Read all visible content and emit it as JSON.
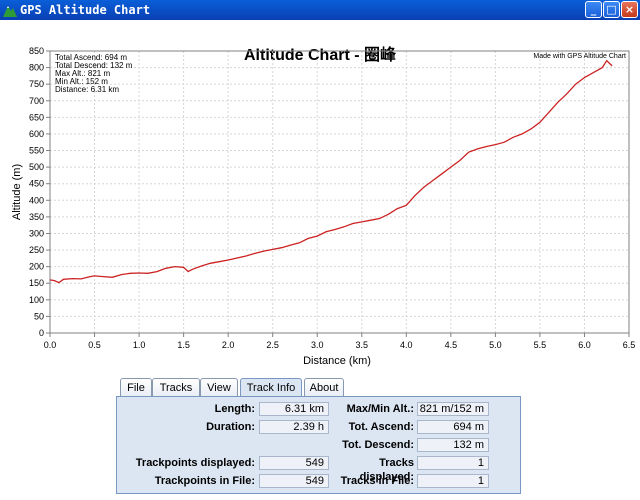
{
  "window": {
    "title": "GPS Altitude Chart",
    "buttons": {
      "minimize": "_",
      "maximize": "□",
      "close": "×"
    }
  },
  "chart": {
    "title": "Altitude Chart - 圈峰",
    "stats": [
      "Total Ascend: 694 m",
      "Total Descend: 132 m",
      "Max Alt.: 821 m",
      "Min Alt.: 152 m",
      "Distance: 6.31 km"
    ],
    "watermark": "Made with GPS Altitude Chart"
  },
  "chart_data": {
    "type": "line",
    "title": "Altitude Chart - 圈峰",
    "xlabel": "Distance (km)",
    "ylabel": "Altitude (m)",
    "xlim": [
      0,
      6.5
    ],
    "ylim": [
      0,
      850
    ],
    "xticks": [
      "0.0",
      "0.5",
      "1.0",
      "1.5",
      "2.0",
      "2.5",
      "3.0",
      "3.5",
      "4.0",
      "4.5",
      "5.0",
      "5.5",
      "6.0",
      "6.5"
    ],
    "yticks": [
      "0",
      "50",
      "100",
      "150",
      "200",
      "250",
      "300",
      "350",
      "400",
      "450",
      "500",
      "550",
      "600",
      "650",
      "700",
      "750",
      "800",
      "850"
    ],
    "grid": true,
    "series": [
      {
        "color": "#cc2222",
        "x": [
          0.0,
          0.05,
          0.1,
          0.15,
          0.25,
          0.35,
          0.45,
          0.5,
          0.6,
          0.7,
          0.8,
          0.9,
          1.0,
          1.1,
          1.2,
          1.3,
          1.4,
          1.5,
          1.55,
          1.6,
          1.7,
          1.8,
          1.9,
          2.0,
          2.1,
          2.2,
          2.3,
          2.4,
          2.5,
          2.6,
          2.7,
          2.8,
          2.9,
          3.0,
          3.1,
          3.2,
          3.3,
          3.4,
          3.5,
          3.6,
          3.7,
          3.8,
          3.9,
          4.0,
          4.1,
          4.2,
          4.3,
          4.4,
          4.5,
          4.6,
          4.7,
          4.8,
          4.9,
          5.0,
          5.1,
          5.2,
          5.3,
          5.4,
          5.5,
          5.6,
          5.7,
          5.8,
          5.9,
          6.0,
          6.1,
          6.2,
          6.25,
          6.31
        ],
        "y": [
          160,
          158,
          152,
          162,
          164,
          163,
          170,
          172,
          170,
          168,
          176,
          180,
          181,
          180,
          185,
          195,
          200,
          198,
          185,
          192,
          202,
          210,
          215,
          220,
          226,
          232,
          240,
          247,
          252,
          257,
          265,
          272,
          285,
          292,
          305,
          312,
          320,
          330,
          335,
          340,
          345,
          358,
          375,
          385,
          415,
          440,
          460,
          480,
          500,
          520,
          545,
          555,
          562,
          568,
          575,
          590,
          600,
          615,
          635,
          665,
          695,
          720,
          750,
          770,
          785,
          800,
          821,
          805
        ]
      }
    ]
  },
  "tabs": [
    "File",
    "Tracks",
    "View",
    "Track Info",
    "About"
  ],
  "active_tab": "Track Info",
  "track_info": {
    "length_label": "Length:",
    "length_value": "6.31 km",
    "duration_label": "Duration:",
    "duration_value": "2.39 h",
    "maxmin_label": "Max/Min Alt.:",
    "maxmin_value": "821 m/152 m",
    "ascend_label": "Tot. Ascend:",
    "ascend_value": "694 m",
    "descend_label": "Tot. Descend:",
    "descend_value": "132 m",
    "tp_displayed_label": "Trackpoints displayed:",
    "tp_displayed_value": "549",
    "tracks_displayed_label": "Tracks displayed:",
    "tracks_displayed_value": "1",
    "tp_file_label": "Trackpoints in File:",
    "tp_file_value": "549",
    "tracks_file_label": "Tracks in File:",
    "tracks_file_value": "1"
  }
}
